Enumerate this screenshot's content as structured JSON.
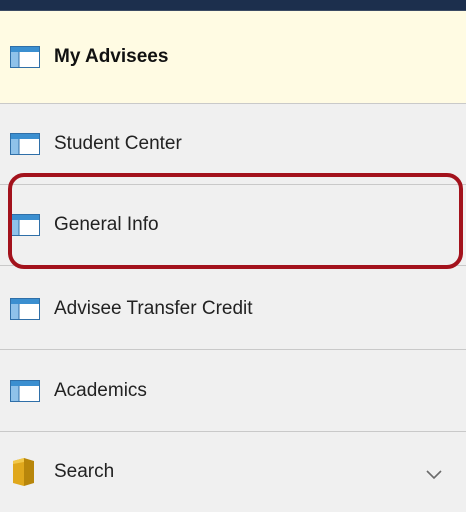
{
  "menu": {
    "items": [
      {
        "label": "My Advisees",
        "icon": "page-icon",
        "selected": true
      },
      {
        "label": "Student Center",
        "icon": "page-icon",
        "selected": false
      },
      {
        "label": "General Info",
        "icon": "page-icon",
        "selected": false,
        "highlighted": true
      },
      {
        "label": "Advisee Transfer Credit",
        "icon": "page-icon",
        "selected": false
      },
      {
        "label": "Academics",
        "icon": "page-icon",
        "selected": false
      },
      {
        "label": "Search",
        "icon": "folder-icon",
        "selected": false,
        "expandable": true
      }
    ]
  },
  "colors": {
    "top_bar": "#1c2f4d",
    "selected_background": "#fffbe3",
    "item_background": "#f0f0f0",
    "highlight_ring": "#a3121c",
    "icon_blue": "#3b8fd0",
    "folder_gold": "#d4a017"
  }
}
